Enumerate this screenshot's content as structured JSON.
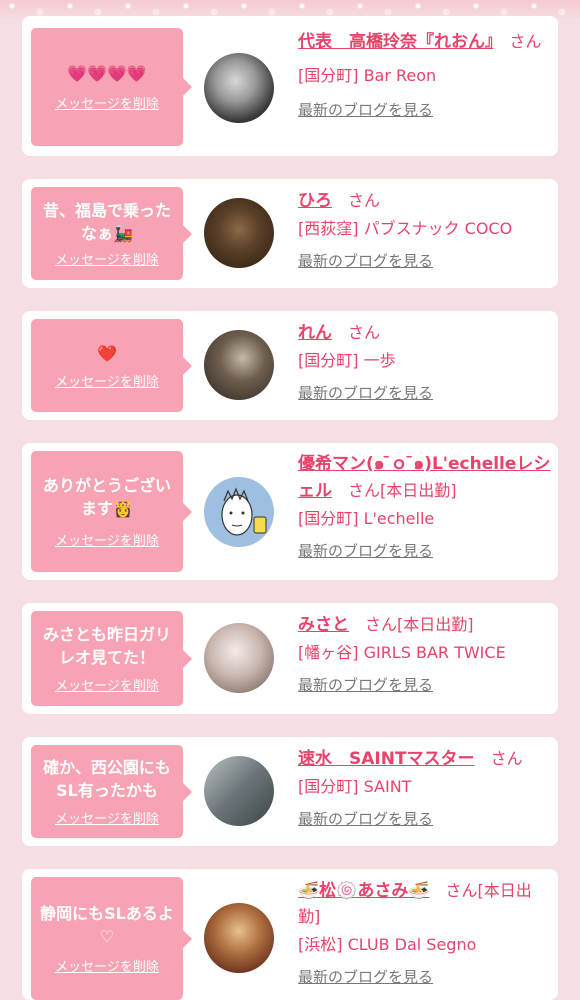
{
  "delete_label": "メッセージを削除",
  "blog_label": "最新のブログを見る",
  "san_suffix": "さん",
  "entries": [
    {
      "message": "💗💗💗💗",
      "name": "代表　高橋玲奈『れおん』",
      "status": "",
      "location": "[国分町] Bar Reon"
    },
    {
      "message": "昔、福島で乗ったなぁ🚂",
      "name": "ひろ",
      "status": "",
      "location": "[西荻窪] パブスナック COCO"
    },
    {
      "message": "❤️",
      "name": "れん",
      "status": "",
      "location": "[国分町] 一歩"
    },
    {
      "message": "ありがとうございます👸",
      "name": "優希マン(๑ ̄ｏ ̄๑)L'echelleレシェル",
      "status": "[本日出勤]",
      "location": "[国分町] L'echelle"
    },
    {
      "message": "みさとも昨日ガリレオ見てた！",
      "name": "みさと",
      "status": "[本日出勤]",
      "location": "[幡ヶ谷] GIRLS BAR TWICE"
    },
    {
      "message": "確か、西公園にもSL有ったかも",
      "name": "速水　SAINTマスター",
      "status": "",
      "location": "[国分町] SAINT"
    },
    {
      "message": "静岡にもSLあるよ♡",
      "name": "🍜松🍥あさみ🍜",
      "status": "[本日出勤]",
      "location": "[浜松] CLUB Dal Segno"
    }
  ]
}
